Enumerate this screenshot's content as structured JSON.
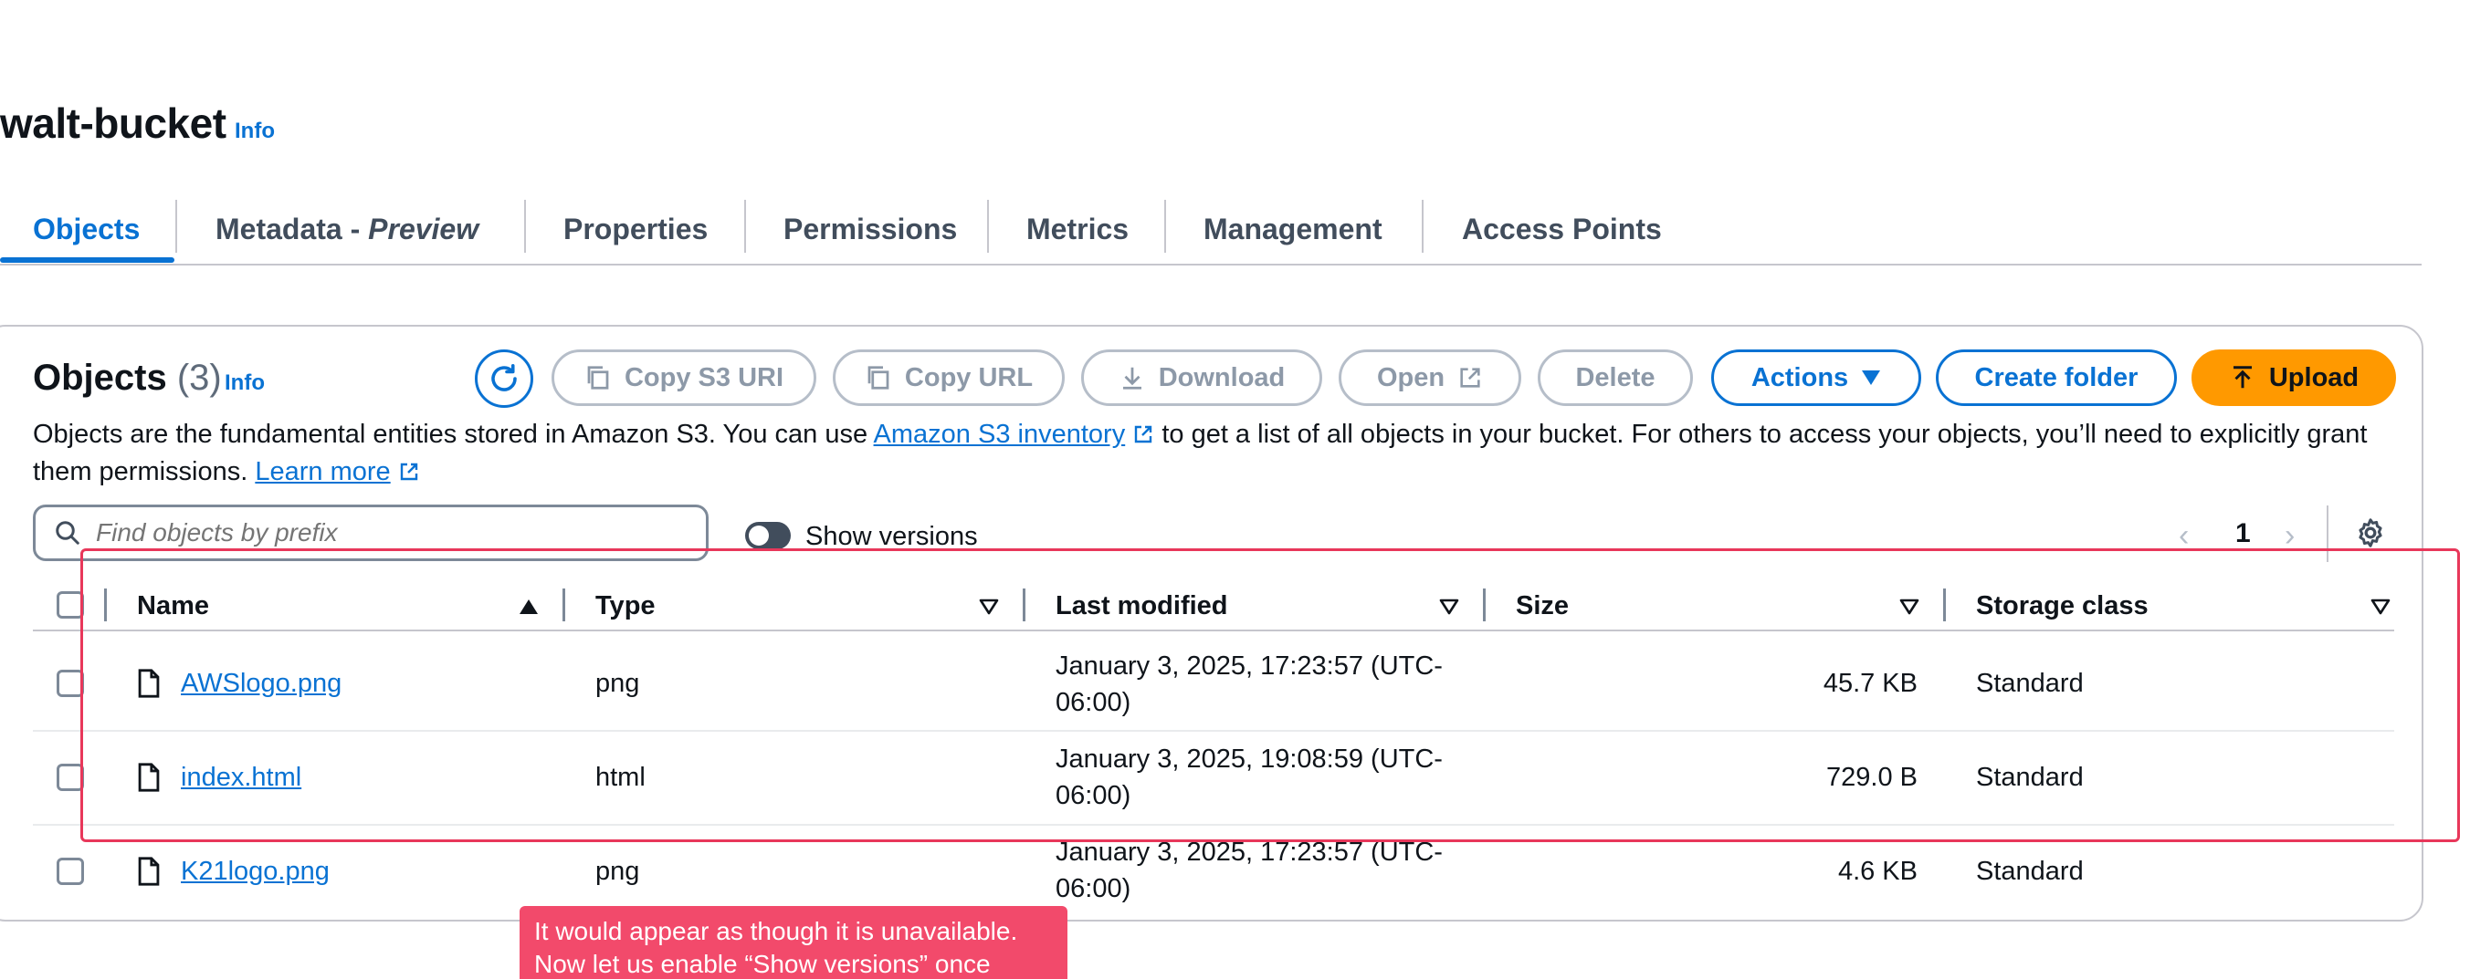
{
  "bucket": {
    "title": "walt-bucket",
    "info": "Info"
  },
  "tabs": [
    {
      "label": "Objects"
    },
    {
      "label": "Metadata - ",
      "label_em": "Preview"
    },
    {
      "label": "Properties"
    },
    {
      "label": "Permissions"
    },
    {
      "label": "Metrics"
    },
    {
      "label": "Management"
    },
    {
      "label": "Access Points"
    }
  ],
  "objects": {
    "heading": "Objects",
    "count": "(3)",
    "info": "Info",
    "buttons": {
      "copy_s3_uri": "Copy S3 URI",
      "copy_url": "Copy URL",
      "download": "Download",
      "open": "Open",
      "delete": "Delete",
      "actions": "Actions",
      "create_folder": "Create folder",
      "upload": "Upload"
    },
    "description": {
      "part1": "Objects are the fundamental entities stored in Amazon S3. You can use ",
      "link1": "Amazon S3 inventory",
      "part2": " to get a list of all objects in your bucket. For others to access your objects, you’ll need to explicitly grant them permissions. ",
      "link2": "Learn more"
    },
    "search": {
      "placeholder": "Find objects by prefix",
      "value": ""
    },
    "show_versions": {
      "label": "Show versions",
      "enabled": false
    },
    "pagination": {
      "page": "1"
    }
  },
  "table": {
    "columns": [
      "Name",
      "Type",
      "Last modified",
      "Size",
      "Storage class"
    ],
    "rows": [
      {
        "name": "AWSlogo.png",
        "type": "png",
        "last_modified": "January 3, 2025, 17:23:57 (UTC-06:00)",
        "size": "45.7 KB",
        "storage_class": "Standard"
      },
      {
        "name": "index.html",
        "type": "html",
        "last_modified": "January 3, 2025, 19:08:59 (UTC-06:00)",
        "size": "729.0 B",
        "storage_class": "Standard"
      },
      {
        "name": "K21logo.png",
        "type": "png",
        "last_modified": "January 3, 2025, 17:23:57 (UTC-06:00)",
        "size": "4.6 KB",
        "storage_class": "Standard"
      }
    ]
  },
  "annotation": {
    "tooltip": "It would appear as though it is unavailable. Now let us enable “Show versions” once",
    "highlight_color": "#e8375a"
  },
  "colors": {
    "accent": "#0972d3",
    "upload": "#ff9900",
    "disabled": "#8d99a8"
  }
}
